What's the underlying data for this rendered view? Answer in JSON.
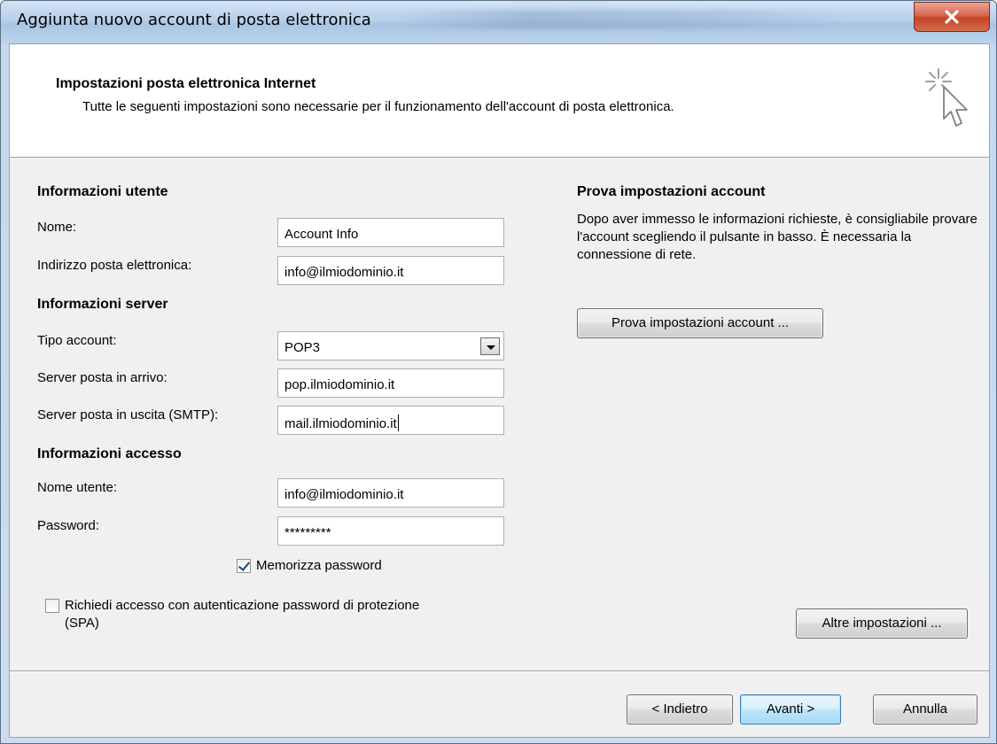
{
  "window": {
    "title": "Aggiunta nuovo account di posta elettronica",
    "close_label": "X"
  },
  "header": {
    "title": "Impostazioni posta elettronica Internet",
    "subtitle": "Tutte le seguenti impostazioni sono necessarie per il funzionamento dell'account di posta elettronica."
  },
  "user_info": {
    "heading": "Informazioni utente",
    "name_label": "Nome:",
    "name_value": "Account Info",
    "email_label": "Indirizzo posta elettronica:",
    "email_value": "info@ilmiodominio.it"
  },
  "server_info": {
    "heading": "Informazioni server",
    "type_label": "Tipo account:",
    "type_value": "POP3",
    "incoming_label": "Server posta in arrivo:",
    "incoming_value": "pop.ilmiodominio.it",
    "outgoing_label": "Server posta in uscita (SMTP):",
    "outgoing_value": "mail.ilmiodominio.it"
  },
  "access_info": {
    "heading": "Informazioni accesso",
    "username_label": "Nome utente:",
    "username_value": "info@ilmiodominio.it",
    "password_label": "Password:",
    "password_value": "*********",
    "remember_label": "Memorizza password",
    "remember_checked": true,
    "spa_label_line1": "Richiedi accesso con autenticazione password di protezione",
    "spa_label_line2": "(SPA)",
    "spa_checked": false
  },
  "test_settings": {
    "heading": "Prova impostazioni account",
    "description": "Dopo aver immesso le informazioni richieste, è consigliabile provare l'account scegliendo il pulsante in basso. È necessaria la connessione di rete.",
    "test_button": "Prova impostazioni account ...",
    "more_button": "Altre impostazioni ..."
  },
  "footer": {
    "back_button": "< Indietro",
    "next_button": "Avanti >",
    "cancel_button": "Annulla"
  }
}
